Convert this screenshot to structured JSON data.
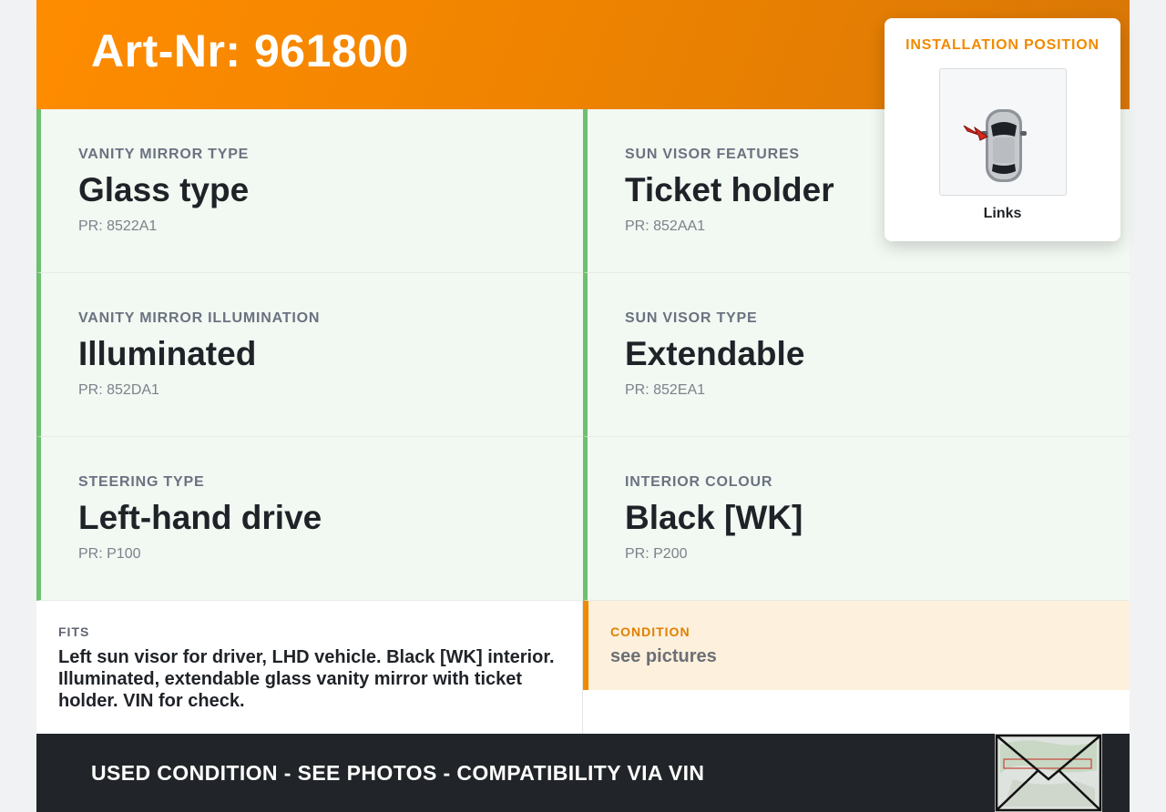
{
  "header": {
    "article": "Art-Nr: 961800"
  },
  "specs": [
    {
      "label": "VANITY MIRROR TYPE",
      "value": "Glass type",
      "pr": "PR: 8522A1"
    },
    {
      "label": "SUN VISOR FEATURES",
      "value": "Ticket holder",
      "pr": "PR: 852AA1"
    },
    {
      "label": "VANITY MIRROR ILLUMINATION",
      "value": "Illuminated",
      "pr": "PR: 852DA1"
    },
    {
      "label": "SUN VISOR TYPE",
      "value": "Extendable",
      "pr": "PR: 852EA1"
    },
    {
      "label": "STEERING TYPE",
      "value": "Left-hand drive",
      "pr": "PR: P100"
    },
    {
      "label": "INTERIOR COLOUR",
      "value": "Black [WK]",
      "pr": "PR: P200"
    }
  ],
  "fits": {
    "label": "FITS",
    "text": "Left sun visor for driver, LHD vehicle. Black [WK] interior. Illuminated, extendable glass vanity mirror with ticket holder. VIN for check."
  },
  "condition": {
    "label": "CONDITION",
    "text": "see pictures"
  },
  "footer": {
    "text": "USED CONDITION - SEE PHOTOS - COMPATIBILITY VIA VIN"
  },
  "install": {
    "title": "INSTALLATION POSITION",
    "caption": "Links"
  },
  "colors": {
    "accent": "#f08a00",
    "spec_border": "#6cc070",
    "spec_bg": "#f2f8f2",
    "condition_bg": "#fdf0dc",
    "footer_bg": "#212428"
  },
  "icons": {
    "car": "car-top-view-icon",
    "arrow": "red-arrow-icon",
    "envelope": "envelope-icon"
  }
}
